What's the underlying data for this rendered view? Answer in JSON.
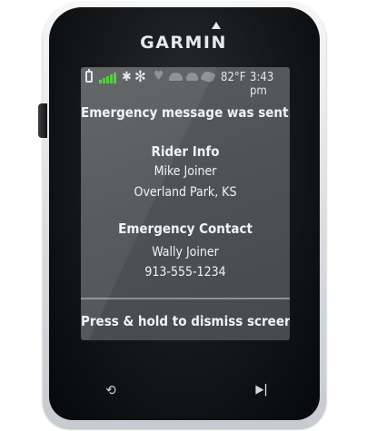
{
  "device": {
    "brand": "GARMIN"
  },
  "status_bar": {
    "icons": [
      "battery-icon",
      "cellular-signal-icon",
      "bluetooth-icon",
      "ant-plus-icon",
      "heart-rate-icon",
      "helmet-icon",
      "helmet-icon",
      "shoe-icon"
    ],
    "signal_color": "#4fc93a",
    "bluetooth_glyph": "✱",
    "ant_glyph": "✻",
    "heart_glyph": "♥",
    "temperature": "82°F",
    "time": "3:43 pm"
  },
  "screen": {
    "headline": "Emergency message was sent.",
    "rider_info_title": "Rider Info",
    "rider_name": "Mike Joiner",
    "rider_location": "Overland Park, KS",
    "emergency_contact_title": "Emergency Contact",
    "contact_name": "Wally Joiner",
    "contact_phone": "913-555-1234",
    "footer_instruction": "Press & hold to dismiss screen."
  },
  "hardware_buttons": {
    "lap_glyph": "⟲",
    "start_stop_glyph": "▶|"
  }
}
